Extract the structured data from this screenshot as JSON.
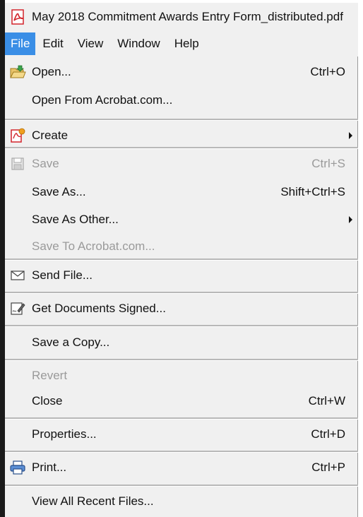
{
  "window": {
    "title": "May 2018 Commitment Awards Entry Form_distributed.pdf"
  },
  "menubar": {
    "items": [
      "File",
      "Edit",
      "View",
      "Window",
      "Help"
    ],
    "active": "File"
  },
  "menu": {
    "open": "Open...",
    "open_shortcut": "Ctrl+O",
    "open_from_acrobat": "Open From Acrobat.com...",
    "create": "Create",
    "save": "Save",
    "save_shortcut": "Ctrl+S",
    "save_as": "Save As...",
    "save_as_shortcut": "Shift+Ctrl+S",
    "save_as_other": "Save As Other...",
    "save_to_acrobat": "Save To Acrobat.com...",
    "send_file": "Send File...",
    "get_documents_signed": "Get Documents Signed...",
    "save_a_copy": "Save a Copy...",
    "revert": "Revert",
    "close": "Close",
    "close_shortcut": "Ctrl+W",
    "properties": "Properties...",
    "properties_shortcut": "Ctrl+D",
    "print": "Print...",
    "print_shortcut": "Ctrl+P",
    "view_all_recent": "View All Recent Files..."
  },
  "icons": {
    "app": "pdf-icon",
    "open": "folder-open-icon",
    "create": "create-pdf-icon",
    "save": "floppy-disk-icon",
    "send": "envelope-icon",
    "sign": "sign-document-icon",
    "print": "printer-icon"
  },
  "colors": {
    "menu_bg": "#f0f0f0",
    "highlight": "#3a8ee6",
    "disabled_text": "#9a9a9a",
    "acrobat_red": "#d2232a"
  }
}
